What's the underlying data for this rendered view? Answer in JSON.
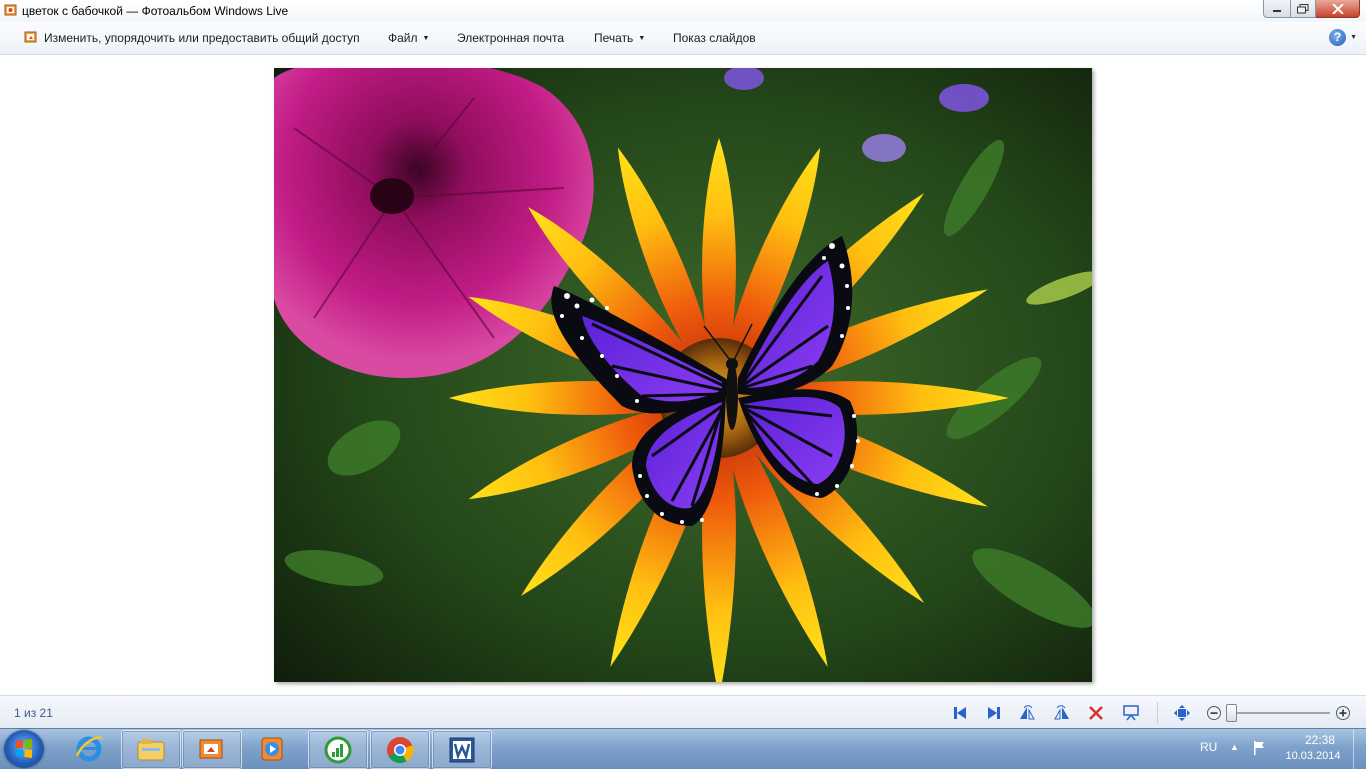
{
  "window": {
    "title": "цветок с бабочкой — Фотоальбом Windows Live",
    "icon": "photo-gallery-icon",
    "controls": [
      "minimize-icon",
      "maximize-icon",
      "close-icon"
    ]
  },
  "menu": {
    "organize_label": "Изменить, упорядочить или предоставить общий доступ",
    "file_label": "Файл",
    "email_label": "Электронная почта",
    "print_label": "Печать",
    "slideshow_label": "Показ слайдов",
    "help_label": "?"
  },
  "photo": {
    "description_icon": "flower-butterfly-photo"
  },
  "controls": {
    "counter": "1 из 21",
    "buttons": [
      "previous-icon",
      "next-icon",
      "rotate-left-icon",
      "rotate-right-icon",
      "delete-icon",
      "slideshow-icon",
      "actual-size-icon",
      "zoom-out-icon",
      "zoom-in-icon"
    ],
    "zoom_level": 0
  },
  "taskbar": {
    "apps": [
      "internet-explorer-icon",
      "windows-explorer-icon",
      "photo-gallery-icon",
      "media-player-icon",
      "task-manager-icon",
      "chrome-icon",
      "word-icon"
    ],
    "language": "RU",
    "time": "22:38",
    "date": "10.03.2014"
  },
  "colors": {
    "accent": "#1f5fb8",
    "close_button": "#c7432a",
    "control_icons": "#2a63c9"
  }
}
